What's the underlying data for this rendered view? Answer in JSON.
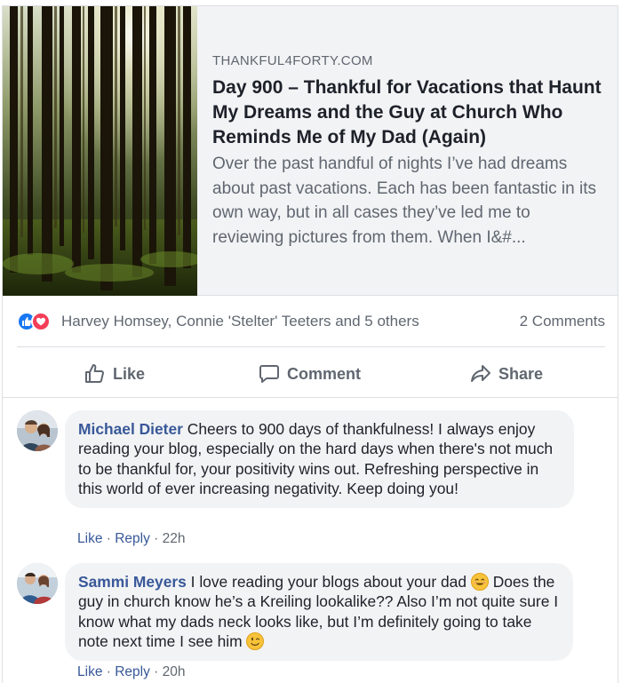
{
  "link_preview": {
    "domain": "THANKFUL4FORTY.COM",
    "title": "Day 900 – Thankful for Vacations that Haunt My Dreams and the Guy at Church Who Reminds Me of My Dad (Again)",
    "description": "Over the past handful of nights I’ve had dreams about past vacations. Each has been fantastic in its own way, but in all cases they’ve led me to reviewing pictures from them. When I&#..."
  },
  "reactions": {
    "icons": [
      "like-reaction-icon",
      "love-reaction-icon"
    ],
    "summary": "Harvey Homsey, Connie 'Stelter' Teeters and 5 others",
    "comments_count": "2 Comments"
  },
  "actions": {
    "like": "Like",
    "comment": "Comment",
    "share": "Share"
  },
  "comments": [
    {
      "author": "Michael Dieter",
      "text": "Cheers to 900 days of thankfulness! I always enjoy reading your blog, especially on the hard days when there's not much to be thankful for, your positivity wins out. Refreshing perspective in this world of ever increasing negativity. Keep doing you!",
      "like": "Like",
      "reply": "Reply",
      "time": "22h"
    },
    {
      "author": "Sammi Meyers",
      "text_part1": "I love reading your blogs about your dad",
      "text_part2": "Does the guy in church know he’s a Kreiling lookalike?? Also I’m not quite sure I know what my dads neck looks like, but I’m definitely going to take note next time I see him",
      "emoji1": "smiling-face-emoji",
      "emoji2": "winking-face-emoji",
      "like": "Like",
      "reply": "Reply",
      "time": "20h"
    }
  ],
  "colors": {
    "link_blue": "#385898",
    "like_blue": "#1877f2",
    "love_red": "#f33e58",
    "bubble_bg": "#f2f3f5",
    "secondary_text": "#606770"
  }
}
